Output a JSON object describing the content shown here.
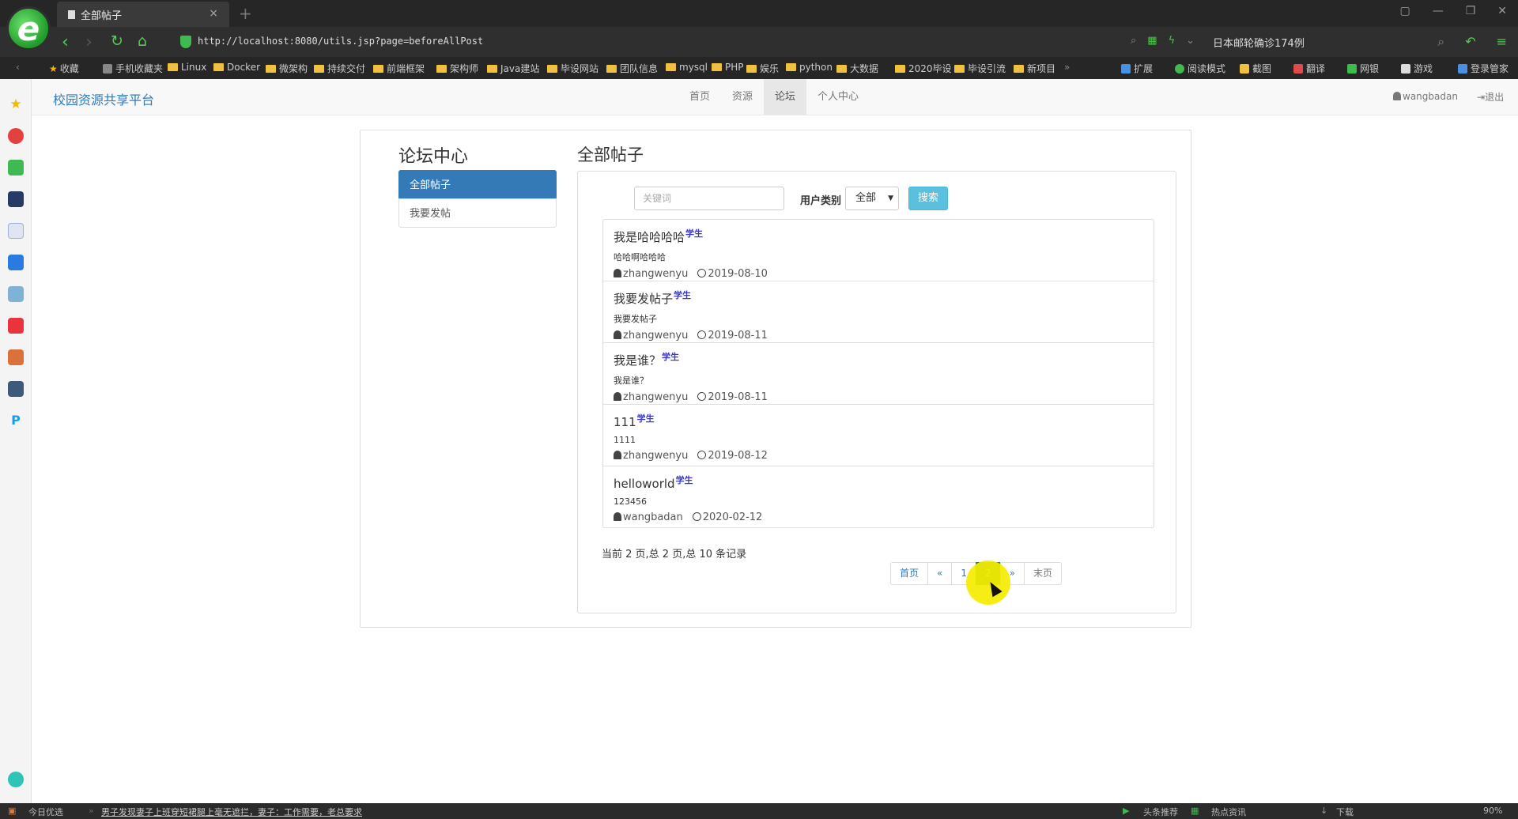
{
  "browser": {
    "tab_title": "全部帖子",
    "new_tab": "+",
    "close_tab": "×",
    "url": "http://localhost:8080/utils.jsp?page=beforeAllPost",
    "hot_search": "日本邮轮确诊174例",
    "bookmarks": [
      "收藏",
      "手机收藏夹",
      "Linux",
      "Docker",
      "微架构",
      "持续交付",
      "前端框架",
      "架构师",
      "Java建站",
      "毕设网站",
      "团队信息",
      "mysql",
      "PHP",
      "娱乐",
      "python",
      "大数据",
      "2020毕设",
      "毕设引流",
      "新项目"
    ],
    "toolbar_right": [
      "扩展",
      "阅读模式",
      "截图",
      "翻译",
      "网银",
      "游戏",
      "登录管家"
    ],
    "status_left": "今日优选",
    "status_news": "男子发现妻子上班穿短裙腿上毫无遮拦，妻子：工作需要，老总要求",
    "status_right": [
      "头条推荐",
      "热点资讯",
      "下载",
      "90%"
    ]
  },
  "site": {
    "brand": "校园资源共享平台",
    "nav": [
      "首页",
      "资源",
      "论坛",
      "个人中心"
    ],
    "active_nav": "论坛",
    "username": "wangbadan",
    "logout": "退出"
  },
  "sidebar": {
    "title": "论坛中心",
    "items": [
      "全部帖子",
      "我要发帖"
    ]
  },
  "main": {
    "title": "全部帖子",
    "search": {
      "placeholder": "关键词",
      "user_type_label": "用户类别",
      "user_type_value": "全部",
      "button": "搜索"
    },
    "posts": [
      {
        "title": "我是哈哈哈哈",
        "badge": "学生",
        "content": "哈哈啊哈哈哈",
        "author": "zhangwenyu",
        "date": "2019-08-10"
      },
      {
        "title": "我要发帖子",
        "badge": "学生",
        "content": "我要发帖子",
        "author": "zhangwenyu",
        "date": "2019-08-11"
      },
      {
        "title": "我是谁？",
        "badge": "学生",
        "content": "我是谁？",
        "author": "zhangwenyu",
        "date": "2019-08-11"
      },
      {
        "title": "111",
        "badge": "学生",
        "content": "1111",
        "author": "zhangwenyu",
        "date": "2019-08-12"
      },
      {
        "title": "helloworld",
        "badge": "学生",
        "content": "123456",
        "author": "wangbadan",
        "date": "2020-02-12"
      }
    ],
    "page_info": "当前 2 页,总 2 页,总 10 条记录",
    "pagination": [
      "首页",
      "«",
      "1",
      "2",
      "»",
      "末页"
    ],
    "current_page": "2"
  }
}
